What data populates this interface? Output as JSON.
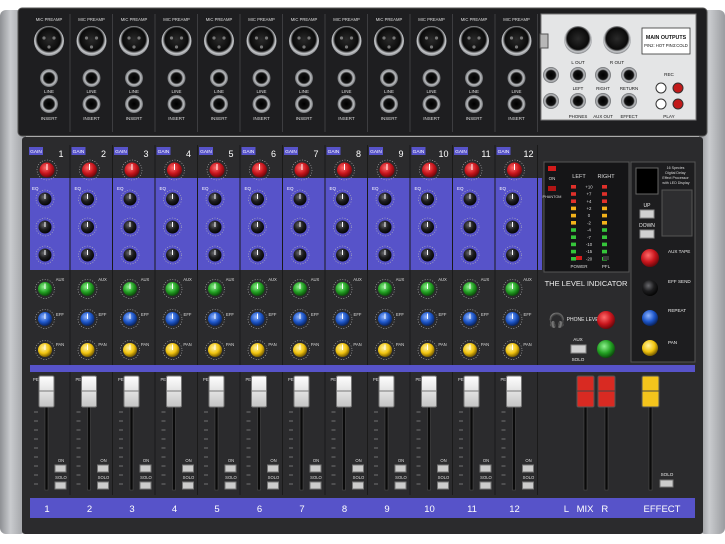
{
  "top_panel": {
    "mic_preamp_label": "MIC PREAMP",
    "line_label": "LINE",
    "insert_label": "INSERT",
    "main_out_label": "MAIN OUTPUTS",
    "main_out_sub": "PIN2: HOT PIN3:COLD",
    "l_out": "L OUT",
    "r_out": "R OUT",
    "left": "LEFT",
    "right": "RIGHT",
    "return": "RETURN",
    "phones": "PHONES",
    "aux_out": "AUX OUT",
    "effect": "EFFECT",
    "rec": "REC",
    "play": "PLAY"
  },
  "channel_labels": {
    "gain": "GAIN",
    "eq": "EQ",
    "aux": "AUX",
    "eff": "EFF",
    "pan": "PAN",
    "peak": "PEAK",
    "on": "ON",
    "solo": "SOLO"
  },
  "channels": [
    "1",
    "2",
    "3",
    "4",
    "5",
    "6",
    "7",
    "8",
    "9",
    "10",
    "11",
    "12"
  ],
  "meter": {
    "left": "LEFT",
    "right": "RIGHT",
    "on": "ON",
    "phantom": "PHANTOM",
    "power": "POWER",
    "pfl": "PFL",
    "scale": [
      "+10",
      "+7",
      "+4",
      "+2",
      "0",
      "-2",
      "-4",
      "-7",
      "-10",
      "-15",
      "-20"
    ],
    "title": "THE LEVEL INDICATOR"
  },
  "master": {
    "phone_level": "PHONE LEVEL",
    "aux": "AUX",
    "solo": "SOLO",
    "up": "UP",
    "down": "DOWN",
    "aux_tape": "AUX TAPE",
    "eff_send": "EFF SEND",
    "repeat": "REPEAT",
    "pan": "PAN",
    "solo_label": "SOLO",
    "fx_desc": "16 Species Digital Delay Effect Processor with LED Display"
  },
  "bottom_labels": {
    "mix": "L   MIX   R",
    "effect": "EFFECT"
  },
  "colors": {
    "body": "#2b2b2d",
    "panel_top": "#1e1e20",
    "frame": "#a9abae",
    "eq_band": "#5753c9",
    "channel_strip_band": "#5753c9",
    "knob_red": "#d01e25",
    "knob_green": "#2aa82a",
    "knob_blue": "#1e58c8",
    "knob_yellow": "#f1c40f",
    "fader_red": "#d92a22",
    "fader_yellow": "#f4c41c"
  }
}
